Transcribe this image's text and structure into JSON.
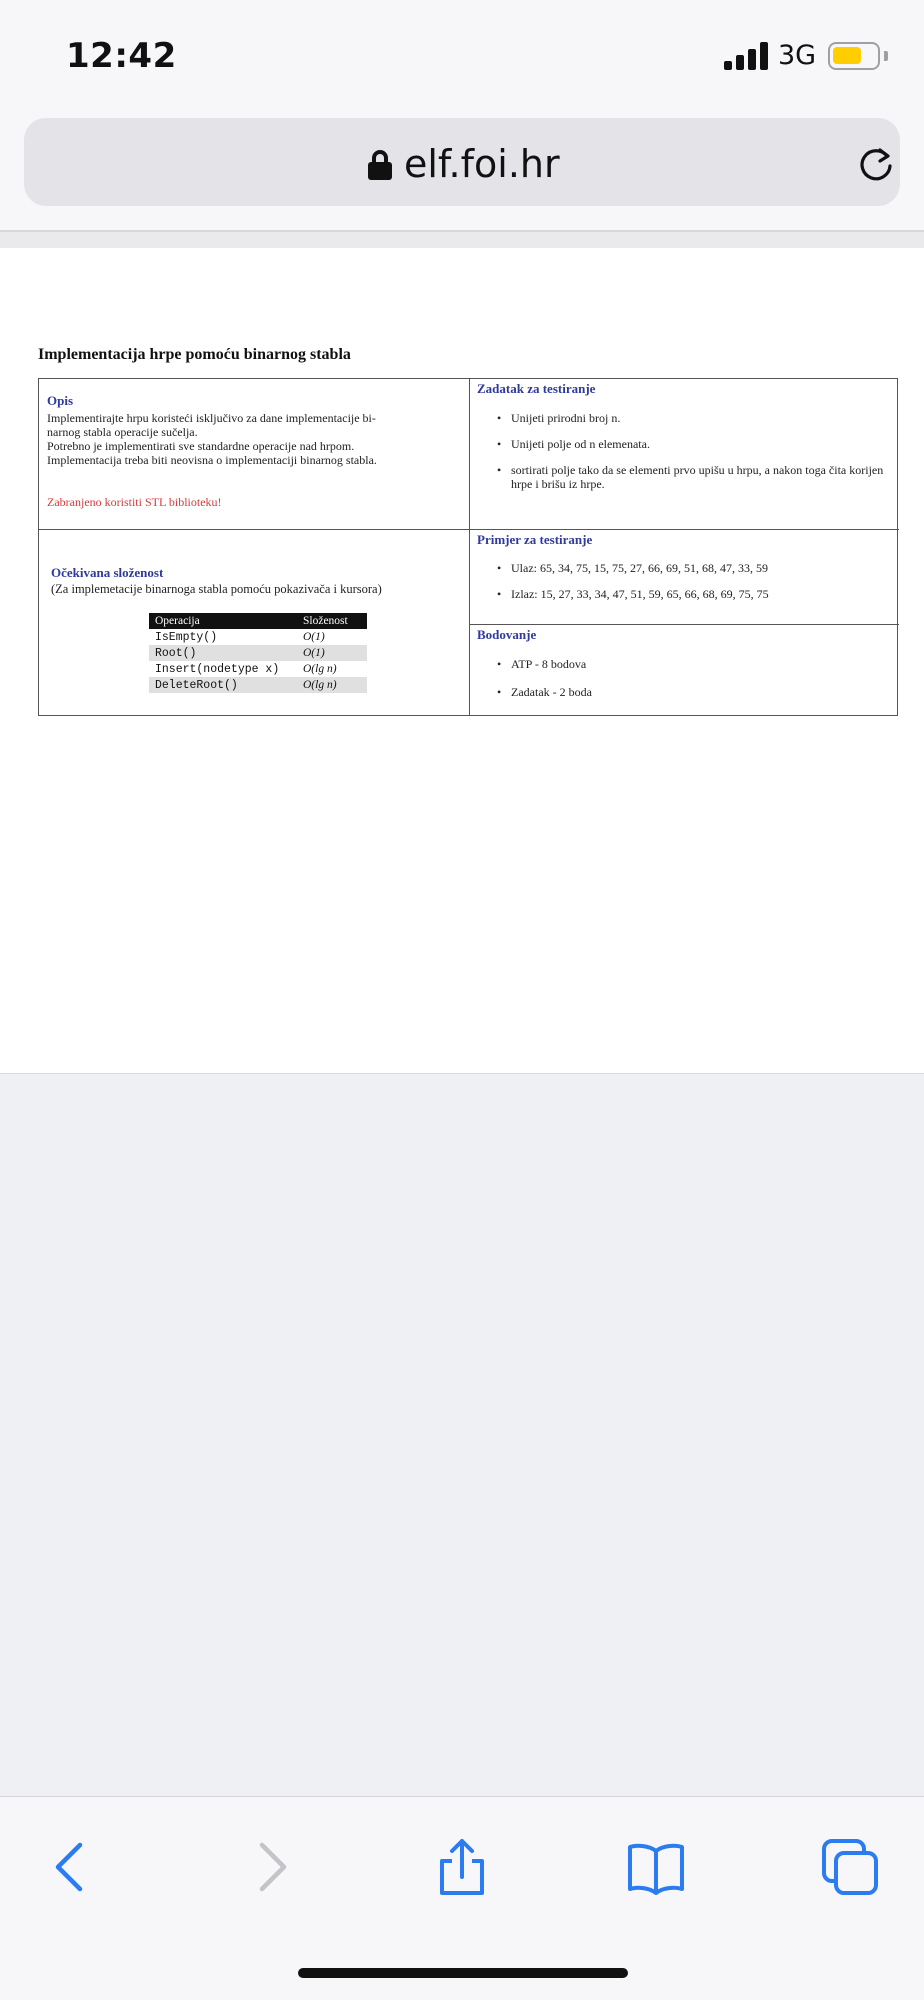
{
  "status_bar": {
    "time": "12:42",
    "network": "3G"
  },
  "browser": {
    "url": "elf.foi.hr"
  },
  "document": {
    "title": "Implementacija hrpe pomoću binarnog stabla",
    "opis": {
      "heading": "Opis",
      "lines": [
        "Implementirajte hrpu koristeći isključivo za dane implementacije bi-",
        "narnog stabla operacije sučelja.",
        "Potrebno je implementirati sve standardne operacije nad hrpom.",
        "Implementacija treba biti neovisna o implementaciji binarnog stabla."
      ],
      "warning": "Zabranjeno koristiti STL biblioteku!"
    },
    "slozenost": {
      "heading": "Očekivana složenost",
      "subtitle": "(Za implemetacije binarnoga stabla pomoću pokazivača i kursora)",
      "columns": [
        "Operacija",
        "Složenost"
      ],
      "rows": [
        [
          "IsEmpty()",
          "O(1)"
        ],
        [
          "Root()",
          "O(1)"
        ],
        [
          "Insert(nodetype x)",
          "O(lg n)"
        ],
        [
          "DeleteRoot()",
          "O(lg n)"
        ]
      ]
    },
    "zadatak": {
      "heading": "Zadatak za testiranje",
      "items": [
        "Unijeti prirodni broj n.",
        "Unijeti polje od n elemenata.",
        "sortirati polje tako da se elementi prvo upišu u hrpu, a nakon toga čita korijen hrpe i brišu iz hrpe."
      ]
    },
    "primjer": {
      "heading": "Primjer za testiranje",
      "items": [
        "Ulaz: 65, 34, 75, 15, 75, 27, 66, 69, 51, 68, 47, 33, 59",
        "Izlaz: 15, 27, 33, 34, 47, 51, 59, 65, 66, 68, 69, 75, 75"
      ]
    },
    "bodovanje": {
      "heading": "Bodovanje",
      "items": [
        "ATP - 8 bodova",
        "Zadatak - 2 boda"
      ]
    }
  },
  "toolbar": {
    "icons": [
      "back-icon",
      "forward-icon",
      "share-icon",
      "bookmarks-icon",
      "tabs-icon"
    ],
    "accent": "#2a7cf0",
    "disabled": "#c4c4c8"
  }
}
